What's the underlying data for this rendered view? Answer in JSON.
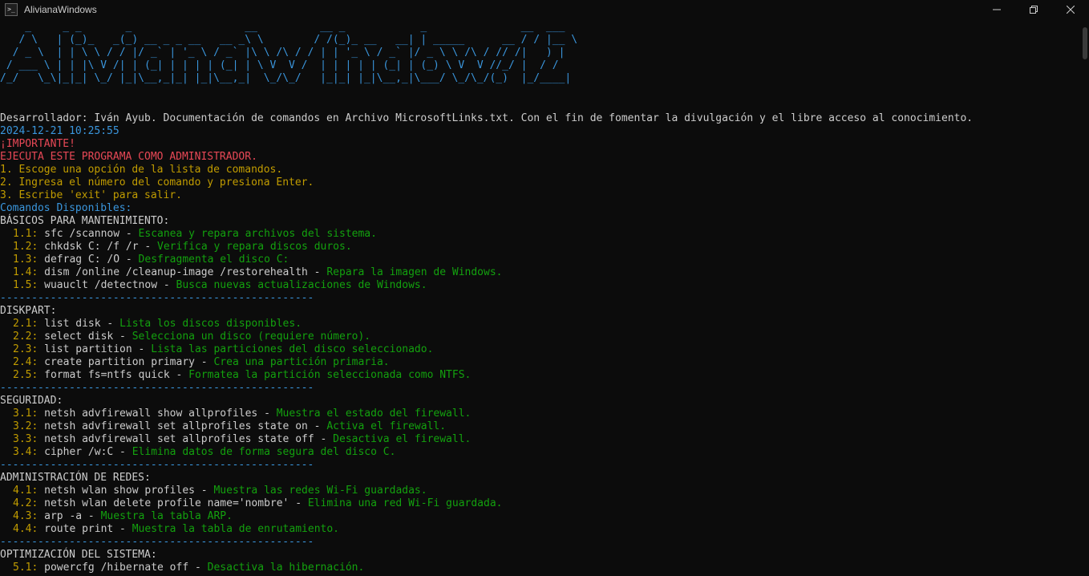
{
  "window": {
    "title": "AlivianaWindows",
    "icon": "console-icon",
    "controls": [
      "minimize-icon",
      "maximize-icon",
      "close-icon"
    ]
  },
  "banner": {
    "lines": [
      "    _     _ _       _                  __          __ _            _               __  ___",
      "   / \\   | (_)_   _(_) __ _ _ __   __ _\\ \\        / /(_)_ __   __| | _____      __ / / |__ \\",
      "  / _ \\  | | \\ \\ / / |/ _` | '_ \\ / _` |\\ \\ /\\ / / | | '_ \\ / _` |/ _ \\ \\ /\\ / // /|   ) |",
      " / ___ \\ | | |\\ V /| | (_| | | | | (_| | \\ V  V /  | | | | | (_| | (_) \\ V  V //_/ |  / /",
      "/_/   \\_\\|_|_| \\_/ |_|\\__,_|_| |_|\\__,_|  \\_/\\_/   |_|_| |_|\\__,_|\\___/ \\_/\\_/(_)  |_/____|"
    ]
  },
  "intro": {
    "developer": "Desarrollador: Iván Ayub. Documentación de comandos en Archivo MicrosoftLinks.txt. Con el fin de fomentar la divulgación y el libre acceso al conocimiento.",
    "timestamp": "2024-12-21 10:25:55",
    "important": "¡IMPORTANTE!",
    "run_as_admin": "EJECUTA ESTE PROGRAMA COMO ADMINISTRADOR.",
    "step1": "1. Escoge una opción de la lista de comandos.",
    "step2": "2. Ingresa el número del comando y presiona Enter.",
    "step3": "3. Escribe 'exit' para salir.",
    "available": "Comandos Disponibles:"
  },
  "separator": "--------------------------------------------------",
  "sections": [
    {
      "title": "BÁSICOS PARA MANTENIMIENTO:",
      "commands": [
        {
          "num": "1.1:",
          "cmd": " sfc /scannow - ",
          "desc": "Escanea y repara archivos del sistema."
        },
        {
          "num": "1.2:",
          "cmd": " chkdsk C: /f /r - ",
          "desc": "Verifica y repara discos duros."
        },
        {
          "num": "1.3:",
          "cmd": " defrag C: /O - ",
          "desc": "Desfragmenta el disco C:"
        },
        {
          "num": "1.4:",
          "cmd": " dism /online /cleanup-image /restorehealth - ",
          "desc": "Repara la imagen de Windows."
        },
        {
          "num": "1.5:",
          "cmd": " wuauclt /detectnow - ",
          "desc": "Busca nuevas actualizaciones de Windows."
        }
      ]
    },
    {
      "title": "DISKPART:",
      "commands": [
        {
          "num": "2.1:",
          "cmd": " list disk - ",
          "desc": "Lista los discos disponibles."
        },
        {
          "num": "2.2:",
          "cmd": " select disk - ",
          "desc": "Selecciona un disco (requiere número)."
        },
        {
          "num": "2.3:",
          "cmd": " list partition - ",
          "desc": "Lista las particiones del disco seleccionado."
        },
        {
          "num": "2.4:",
          "cmd": " create partition primary - ",
          "desc": "Crea una partición primaria."
        },
        {
          "num": "2.5:",
          "cmd": " format fs=ntfs quick - ",
          "desc": "Formatea la partición seleccionada como NTFS."
        }
      ]
    },
    {
      "title": "SEGURIDAD:",
      "commands": [
        {
          "num": "3.1:",
          "cmd": " netsh advfirewall show allprofiles - ",
          "desc": "Muestra el estado del firewall."
        },
        {
          "num": "3.2:",
          "cmd": " netsh advfirewall set allprofiles state on - ",
          "desc": "Activa el firewall."
        },
        {
          "num": "3.3:",
          "cmd": " netsh advfirewall set allprofiles state off - ",
          "desc": "Desactiva el firewall."
        },
        {
          "num": "3.4:",
          "cmd": " cipher /w:C - ",
          "desc": "Elimina datos de forma segura del disco C."
        }
      ]
    },
    {
      "title": "ADMINISTRACIÓN DE REDES:",
      "commands": [
        {
          "num": "4.1:",
          "cmd": " netsh wlan show profiles - ",
          "desc": "Muestra las redes Wi-Fi guardadas."
        },
        {
          "num": "4.2:",
          "cmd": " netsh wlan delete profile name='nombre' - ",
          "desc": "Elimina una red Wi-Fi guardada."
        },
        {
          "num": "4.3:",
          "cmd": " arp -a - ",
          "desc": "Muestra la tabla ARP."
        },
        {
          "num": "4.4:",
          "cmd": " route print - ",
          "desc": "Muestra la tabla de enrutamiento."
        }
      ]
    },
    {
      "title": "OPTIMIZACIÓN DEL SISTEMA:",
      "commands": [
        {
          "num": "5.1:",
          "cmd": " powercfg /hibernate off - ",
          "desc": "Desactiva la hibernación."
        }
      ]
    }
  ],
  "colors": {
    "background": "#0c0c0c",
    "text": "#cccccc",
    "blue": "#3a96dd",
    "red": "#e74856",
    "yellow": "#c19c00",
    "green": "#13a10e"
  }
}
